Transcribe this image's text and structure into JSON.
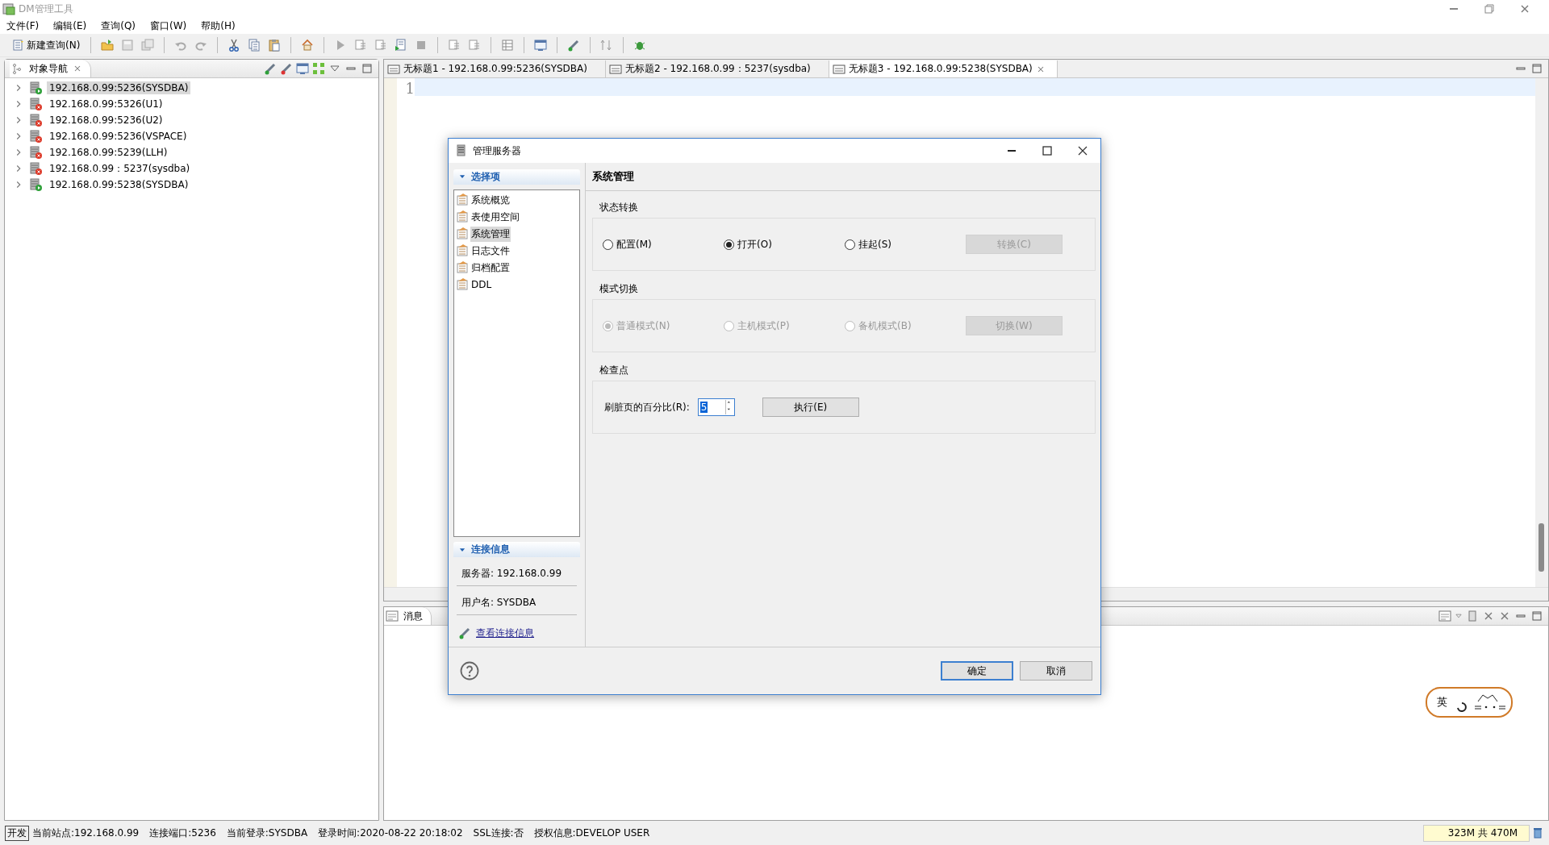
{
  "window": {
    "title": "DM管理工具"
  },
  "menu": [
    "文件(F)",
    "编辑(E)",
    "查询(Q)",
    "窗口(W)",
    "帮助(H)"
  ],
  "toolbar": {
    "new_query": "新建查询(N)"
  },
  "navigator": {
    "title": "对象导航",
    "nodes": [
      {
        "label": "192.168.0.99:5236(SYSDBA)",
        "selected": true,
        "connected": true
      },
      {
        "label": "192.168.0.99:5326(U1)",
        "selected": false,
        "connected": false
      },
      {
        "label": "192.168.0.99:5236(U2)",
        "selected": false,
        "connected": false
      },
      {
        "label": "192.168.0.99:5236(VSPACE)",
        "selected": false,
        "connected": false
      },
      {
        "label": "192.168.0.99:5239(LLH)",
        "selected": false,
        "connected": false
      },
      {
        "label": "192.168.0.99：5237(sysdba)",
        "selected": false,
        "connected": false
      },
      {
        "label": "192.168.0.99:5238(SYSDBA)",
        "selected": false,
        "connected": true
      }
    ]
  },
  "editor": {
    "tabs": [
      {
        "label": "无标题1 - 192.168.0.99:5236(SYSDBA)",
        "selected": false
      },
      {
        "label": "无标题2 - 192.168.0.99：5237(sysdba)",
        "selected": false
      },
      {
        "label": "无标题3 - 192.168.0.99:5238(SYSDBA)",
        "selected": true
      }
    ],
    "line_numbers": [
      "1"
    ]
  },
  "messages": {
    "title": "消息"
  },
  "dialog": {
    "title": "管理服务器",
    "options_header": "选择项",
    "options": [
      {
        "label": "系统概览",
        "selected": false
      },
      {
        "label": "表使用空间",
        "selected": false
      },
      {
        "label": "系统管理",
        "selected": true
      },
      {
        "label": "日志文件",
        "selected": false
      },
      {
        "label": "归档配置",
        "selected": false
      },
      {
        "label": "DDL",
        "selected": false
      }
    ],
    "connection_header": "连接信息",
    "connection_info": [
      "服务器: 192.168.0.99",
      "用户名: SYSDBA"
    ],
    "connection_link": "查看连接信息",
    "section_title": "系统管理",
    "groups": [
      {
        "title": "状态转换",
        "options": [
          {
            "label": "配置(M)",
            "selected": false,
            "disabled": false
          },
          {
            "label": "打开(O)",
            "selected": true,
            "disabled": false
          },
          {
            "label": "挂起(S)",
            "selected": false,
            "disabled": false
          }
        ],
        "button": {
          "label": "转换(C)",
          "disabled": true
        }
      },
      {
        "title": "模式切换",
        "options": [
          {
            "label": "普通模式(N)",
            "selected": true,
            "disabled": true
          },
          {
            "label": "主机模式(P)",
            "selected": false,
            "disabled": true
          },
          {
            "label": "备机模式(B)",
            "selected": false,
            "disabled": true
          }
        ],
        "button": {
          "label": "切换(W)",
          "disabled": true
        }
      }
    ],
    "checkpoint": {
      "title": "检查点",
      "label": "刷脏页的百分比(R):",
      "value": "5",
      "button": "执行(E)"
    },
    "buttons": [
      {
        "label": "确定",
        "default": true
      },
      {
        "label": "取消",
        "default": false
      }
    ]
  },
  "status_bar": {
    "mode": "开发",
    "items": [
      "当前站点:192.168.0.99",
      "连接端口:5236",
      "当前登录:SYSDBA",
      "登录时间:2020-08-22 20:18:02",
      "SSL连接:否",
      "授权信息:DEVELOP USER"
    ],
    "memory": "323M 共 470M"
  },
  "ime": {
    "label": "英"
  }
}
